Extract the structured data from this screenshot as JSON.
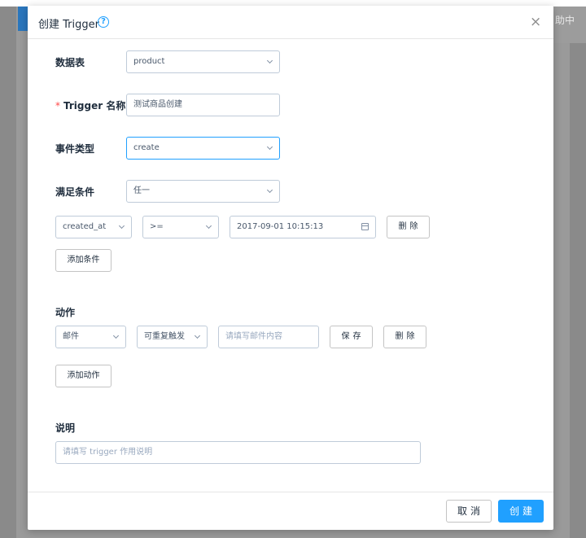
{
  "background": {
    "header_text": "助中"
  },
  "dialog": {
    "title": "创建 Trigger",
    "help_icon": "?",
    "close_icon": "×"
  },
  "form": {
    "table": {
      "label": "数据表",
      "value": "product"
    },
    "trigger_name": {
      "required_mark": "*",
      "label": "Trigger 名称",
      "value": "测试商品创建"
    },
    "event_type": {
      "label": "事件类型",
      "value": "create"
    },
    "condition_match": {
      "label": "满足条件",
      "value": "任一"
    },
    "condition_row": {
      "field": "created_at",
      "operator": ">=",
      "value": "2017-09-01 10:15:13",
      "delete_label": "删除"
    },
    "add_condition_label": "添加条件",
    "actions": {
      "label": "动作",
      "type": "邮件",
      "repeat": "可重复触发",
      "content_placeholder": "请填写邮件内容",
      "save_label": "保存",
      "delete_label": "删除"
    },
    "add_action_label": "添加动作",
    "description": {
      "label": "说明",
      "placeholder": "请填写 trigger 作用说明"
    }
  },
  "footer": {
    "cancel_label": "取消",
    "create_label": "创建"
  },
  "colors": {
    "primary": "#20a0ff",
    "required": "#ff4949",
    "border": "#bfcbd9"
  }
}
